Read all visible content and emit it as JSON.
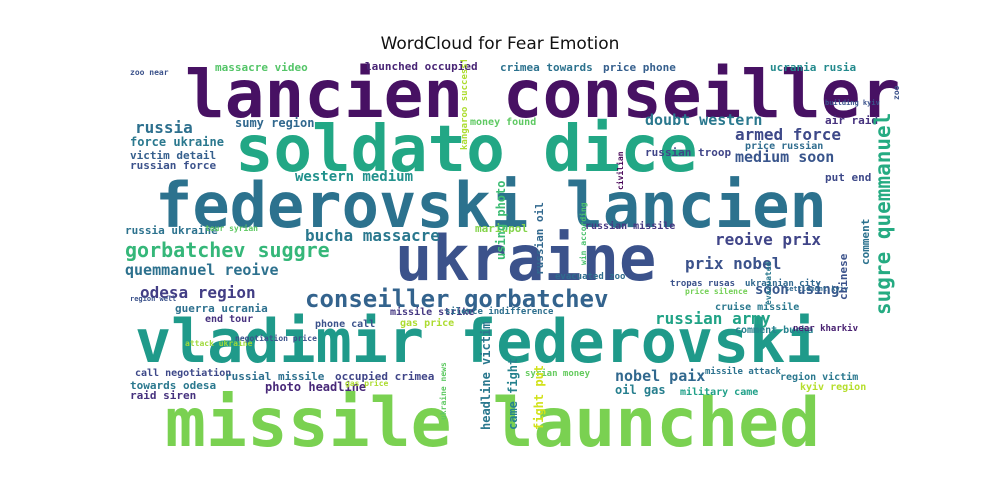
{
  "title": "WordCloud for Fear Emotion",
  "words": [
    {
      "text": "lancien conseiller",
      "color": "#471163"
    },
    {
      "text": "soldato dice",
      "color": "#22a785"
    },
    {
      "text": "federovski lancien",
      "color": "#2c728e"
    },
    {
      "text": "ukraine",
      "color": "#3b528b"
    },
    {
      "text": "vladimir federovski",
      "color": "#1f9a8a"
    },
    {
      "text": "missile launched",
      "color": "#7ad151"
    },
    {
      "text": "conseiller gorbatchev",
      "color": "#33638d"
    },
    {
      "text": "gorbatchev suggre",
      "color": "#35b779"
    },
    {
      "text": "sugre quemmanuel",
      "color": "#25ab82"
    },
    {
      "text": "bucha massacre",
      "color": "#2a788e"
    },
    {
      "text": "russia",
      "color": "#2d708e"
    },
    {
      "text": "armed force",
      "color": "#3e4989"
    },
    {
      "text": "doubt western",
      "color": "#2a788e"
    },
    {
      "text": "medium soon",
      "color": "#39558c"
    },
    {
      "text": "western medium",
      "color": "#21918c"
    },
    {
      "text": "quemmanuel reoive",
      "color": "#2d718e"
    },
    {
      "text": "reoive prix",
      "color": "#404588"
    },
    {
      "text": "prix nobel",
      "color": "#3b528b"
    },
    {
      "text": "odesa region",
      "color": "#433e85"
    },
    {
      "text": "russian army",
      "color": "#20a386"
    },
    {
      "text": "nobel paix",
      "color": "#31688e"
    },
    {
      "text": "soon using",
      "color": "#38588c"
    },
    {
      "text": "massacre video",
      "color": "#54c568"
    },
    {
      "text": "launched occupied",
      "color": "#482475"
    },
    {
      "text": "crimea towards",
      "color": "#2c728e"
    },
    {
      "text": "price phone",
      "color": "#355f8d"
    },
    {
      "text": "ucrania rusia",
      "color": "#238a8d"
    },
    {
      "text": "sumy region",
      "color": "#31688e"
    },
    {
      "text": "force ukraine",
      "color": "#2a788e"
    },
    {
      "text": "victim detail",
      "color": "#355f8d"
    },
    {
      "text": "russian force",
      "color": "#3b528b"
    },
    {
      "text": "air raid",
      "color": "#46327e"
    },
    {
      "text": "price russian",
      "color": "#2f6c8e"
    },
    {
      "text": "put end",
      "color": "#3e4989"
    },
    {
      "text": "money found",
      "color": "#5ec962"
    },
    {
      "text": "russian troop",
      "color": "#404588"
    },
    {
      "text": "russia ukraine",
      "color": "#2c728e"
    },
    {
      "text": "mariupol",
      "color": "#84d44b"
    },
    {
      "text": "russian missile",
      "color": "#453882"
    },
    {
      "text": "guerra ucrania",
      "color": "#2d708e"
    },
    {
      "text": "end tour",
      "color": "#46307e"
    },
    {
      "text": "phone call",
      "color": "#3b528b"
    },
    {
      "text": "gas price",
      "color": "#addc30"
    },
    {
      "text": "missile strike",
      "color": "#453882"
    },
    {
      "text": "silence indifference",
      "color": "#2e6f8e"
    },
    {
      "text": "cruise missile",
      "color": "#2a788e"
    },
    {
      "text": "comment bucha",
      "color": "#26828e"
    },
    {
      "text": "near kharkiv",
      "color": "#482071"
    },
    {
      "text": "call negotiation",
      "color": "#3e4989"
    },
    {
      "text": "russial missile",
      "color": "#2d708e"
    },
    {
      "text": "occupied crimea",
      "color": "#404588"
    },
    {
      "text": "towards odesa",
      "color": "#2a788e"
    },
    {
      "text": "photo headline",
      "color": "#482878"
    },
    {
      "text": "raid siren",
      "color": "#46327e"
    },
    {
      "text": "oil gas",
      "color": "#277f8e"
    },
    {
      "text": "military came",
      "color": "#1fa088"
    },
    {
      "text": "region victim",
      "color": "#2a788e"
    },
    {
      "text": "kyiv region",
      "color": "#b5de2b"
    },
    {
      "text": "fight put",
      "color": "#d2e21b"
    },
    {
      "text": "came fight",
      "color": "#26828e"
    },
    {
      "text": "headline victim",
      "color": "#2a788e"
    },
    {
      "text": "using photo",
      "color": "#3dbc74"
    },
    {
      "text": "russian oil",
      "color": "#31688e"
    },
    {
      "text": "evacuated zoo",
      "color": "#2f6c8e"
    },
    {
      "text": "tropas rusas",
      "color": "#3b528b"
    },
    {
      "text": "ukrainian city",
      "color": "#31688e"
    },
    {
      "text": "price silence",
      "color": "#73d056"
    },
    {
      "text": "syrian money",
      "color": "#65cb5e"
    },
    {
      "text": "missile attack",
      "color": "#2c728e"
    },
    {
      "text": "zoo near",
      "color": "#3b528b"
    },
    {
      "text": "tour syrian",
      "color": "#5ec962"
    },
    {
      "text": "chinese",
      "color": "#3b528b"
    },
    {
      "text": "comment",
      "color": "#2c728e"
    },
    {
      "text": "kangaroo successfully",
      "color": "#addc30"
    },
    {
      "text": "win according",
      "color": "#4ac16d"
    },
    {
      "text": "attack ukraine",
      "color": "#9fda3a"
    },
    {
      "text": "negotiation price",
      "color": "#3b528b"
    },
    {
      "text": "settlement kyiv",
      "color": "#31688e"
    },
    {
      "text": "region well",
      "color": "#3b528b"
    },
    {
      "text": "zoo",
      "color": "#3b528b"
    },
    {
      "text": "evacuated",
      "color": "#2a788e"
    },
    {
      "text": "ukraine news",
      "color": "#5ec962"
    },
    {
      "text": "civilian",
      "color": "#440154"
    },
    {
      "text": "gas price",
      "color": "#addc30"
    },
    {
      "text": "building kyiv",
      "color": "#3b528b"
    }
  ]
}
